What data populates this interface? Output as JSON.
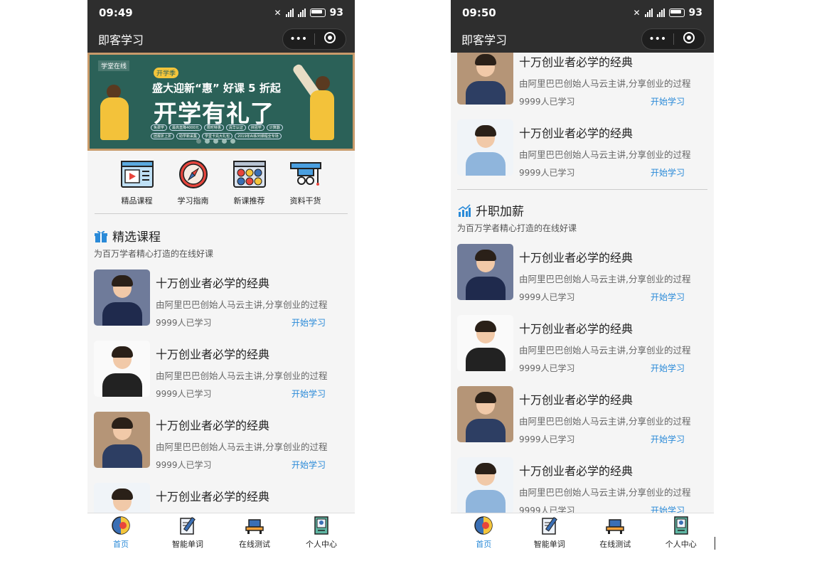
{
  "status": {
    "time_left": "09:49",
    "time_right": "09:50",
    "battery": "93"
  },
  "navbar": {
    "title": "即客学习",
    "more": "•••"
  },
  "banner": {
    "logo": "学堂在线",
    "tag": "开学季",
    "line1": "盛大迎新“惠” 好课 5 折起",
    "line2": "开学有礼了",
    "chips": [
      "免费学",
      "最高直降4000元",
      "限时特惠",
      "清华认证",
      "拼团学",
      "计算器",
      "团报折上折",
      "助学新采集",
      "学堂卡充大礼包",
      "2019年AI系列课程全专场"
    ]
  },
  "quick_nav": [
    {
      "label": "精品课程",
      "icon": "video-course-icon"
    },
    {
      "label": "学习指南",
      "icon": "compass-icon"
    },
    {
      "label": "新课推荐",
      "icon": "palette-icon"
    },
    {
      "label": "资料干货",
      "icon": "graduation-cap-icon"
    }
  ],
  "section1": {
    "title": "精选课程",
    "subtitle": "为百万学者精心打造的在线好课"
  },
  "section2": {
    "title": "升职加薪",
    "subtitle": "为百万学者精心打造的在线好课"
  },
  "course": {
    "title": "十万创业者必学的经典",
    "desc": "由阿里巴巴创始人马云主讲,分享创业的过程",
    "count": "9999人已学习",
    "action": "开始学习"
  },
  "tabbar": [
    {
      "label": "首页",
      "icon": "globe-icon",
      "active": true
    },
    {
      "label": "智能单词",
      "icon": "pencil-icon",
      "active": false
    },
    {
      "label": "在线测试",
      "icon": "desk-icon",
      "active": false
    },
    {
      "label": "个人中心",
      "icon": "profile-icon",
      "active": false
    }
  ],
  "colors": {
    "accent": "#2a8ad8",
    "bar": "#2e2e2e",
    "board": "#2b6158"
  }
}
